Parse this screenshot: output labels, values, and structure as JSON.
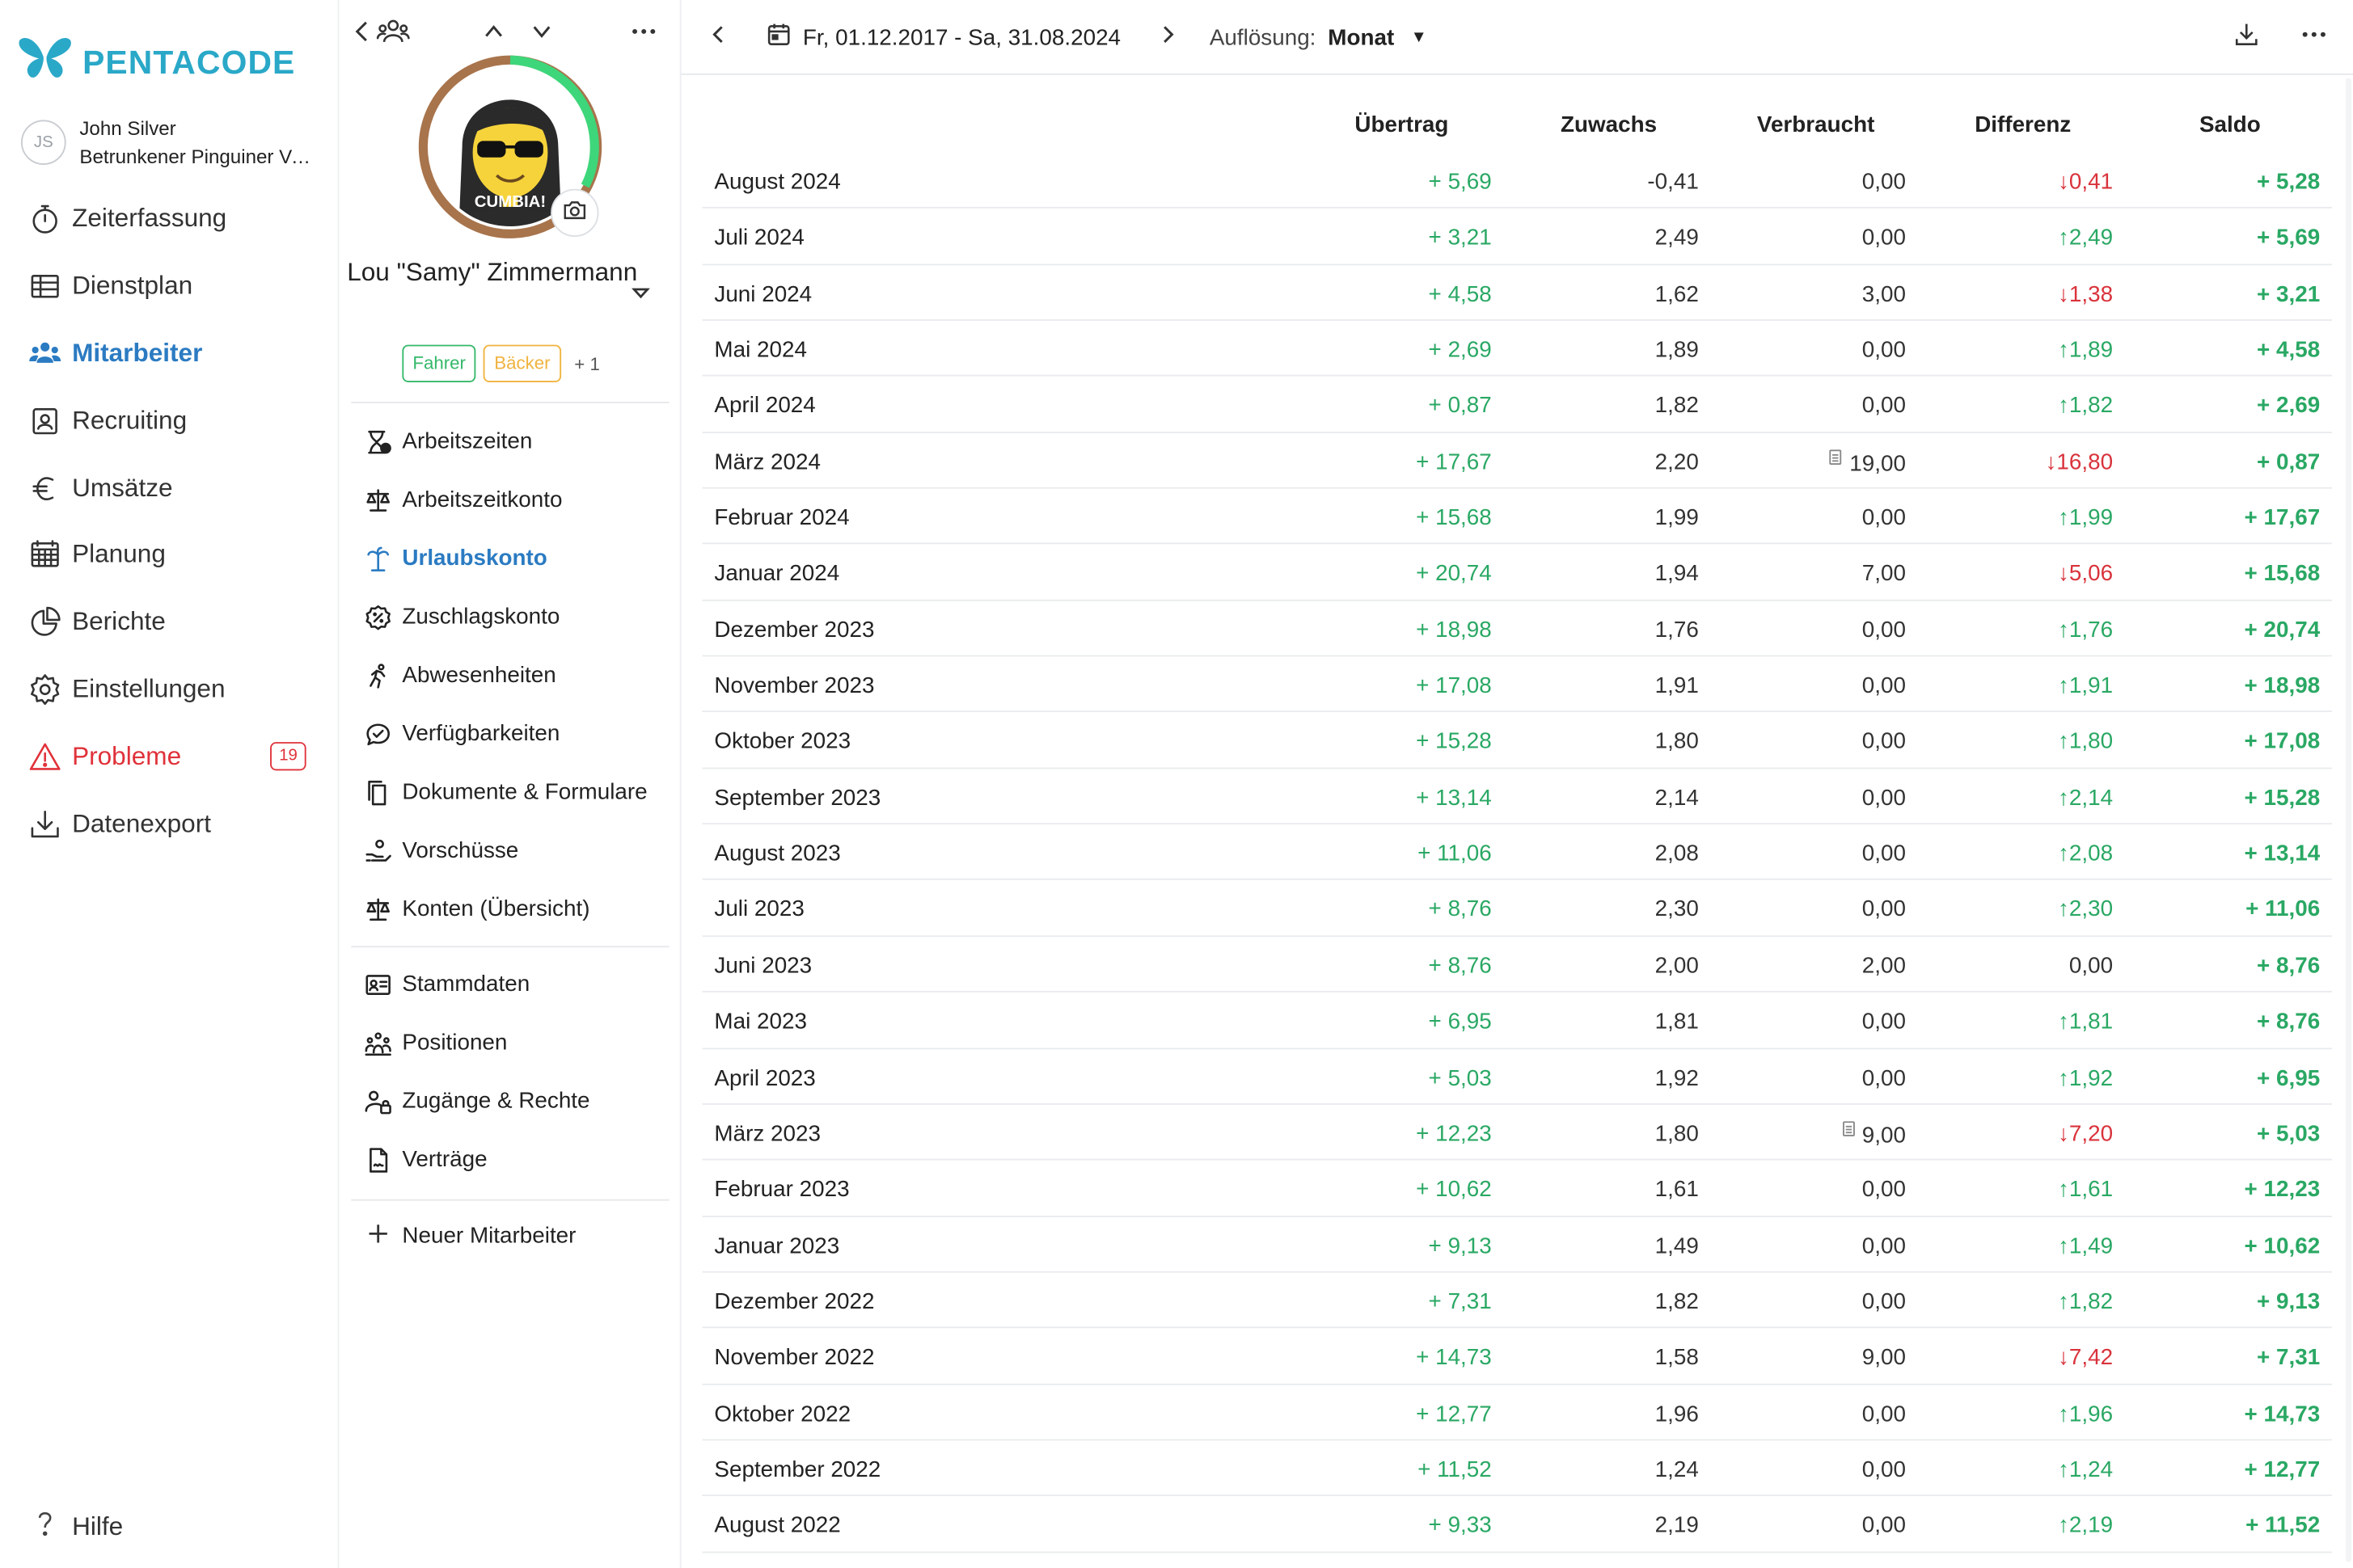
{
  "app": {
    "brand": "PENTACODE",
    "user": {
      "initials": "JS",
      "name": "John Silver",
      "subtitle": "Betrunkener Pinguiner Verwaltung"
    },
    "nav": [
      {
        "id": "zeiterfassung",
        "label": "Zeiterfassung",
        "icon": "stopwatch-icon"
      },
      {
        "id": "dienstplan",
        "label": "Dienstplan",
        "icon": "schedule-table-icon"
      },
      {
        "id": "mitarbeiter",
        "label": "Mitarbeiter",
        "icon": "people-icon",
        "active": true
      },
      {
        "id": "recruiting",
        "label": "Recruiting",
        "icon": "id-badge-icon"
      },
      {
        "id": "umsaetze",
        "label": "Umsätze",
        "icon": "euro-icon"
      },
      {
        "id": "planung",
        "label": "Planung",
        "icon": "calendar-grid-icon"
      },
      {
        "id": "berichte",
        "label": "Berichte",
        "icon": "pie-chart-icon"
      },
      {
        "id": "einstellungen",
        "label": "Einstellungen",
        "icon": "gear-icon"
      },
      {
        "id": "probleme",
        "label": "Probleme",
        "icon": "warning-icon",
        "badge": "19"
      },
      {
        "id": "datenexport",
        "label": "Datenexport",
        "icon": "download-icon"
      }
    ],
    "help_label": "Hilfe",
    "accent": "#2b7bc2",
    "brand_color": "#2aa8c8",
    "positive_color": "#2aa864",
    "negative_color": "#d9333c"
  },
  "employee": {
    "name": "Lou \"Samy\" Zimmermann",
    "avatar_caption": "CUMBIA!",
    "tags": [
      {
        "label": "Fahrer",
        "color": "#35b86a"
      },
      {
        "label": "Bäcker",
        "color": "#f0b33f"
      }
    ],
    "tags_more": "+ 1",
    "menu_primary": [
      {
        "id": "arbeitszeiten",
        "label": "Arbeitszeiten",
        "icon": "hourglass-icon"
      },
      {
        "id": "arbeitszeitkonto",
        "label": "Arbeitszeitkonto",
        "icon": "scales-icon"
      },
      {
        "id": "urlaubskonto",
        "label": "Urlaubskonto",
        "icon": "palm-tree-icon",
        "active": true
      },
      {
        "id": "zuschlagskonto",
        "label": "Zuschlagskonto",
        "icon": "percent-badge-icon"
      },
      {
        "id": "abwesenheiten",
        "label": "Abwesenheiten",
        "icon": "running-person-icon"
      },
      {
        "id": "verfuegbarkeiten",
        "label": "Verfügbarkeiten",
        "icon": "chat-check-icon"
      },
      {
        "id": "dokumente",
        "label": "Dokumente & Formulare",
        "icon": "documents-icon"
      },
      {
        "id": "vorschuesse",
        "label": "Vorschüsse",
        "icon": "hand-coin-icon"
      },
      {
        "id": "konten",
        "label": "Konten (Übersicht)",
        "icon": "scales-icon"
      }
    ],
    "menu_secondary": [
      {
        "id": "stammdaten",
        "label": "Stammdaten",
        "icon": "id-card-icon"
      },
      {
        "id": "positionen",
        "label": "Positionen",
        "icon": "team-icon"
      },
      {
        "id": "zugaenge",
        "label": "Zugänge & Rechte",
        "icon": "user-lock-icon"
      },
      {
        "id": "vertraege",
        "label": "Verträge",
        "icon": "contract-icon"
      }
    ],
    "new_label": "Neuer Mitarbeiter"
  },
  "toolbar": {
    "date_range": "Fr, 01.12.2017 - Sa, 31.08.2024",
    "resolution_label": "Auflösung:",
    "resolution_value": "Monat"
  },
  "table": {
    "columns": [
      "Übertrag",
      "Zuwachs",
      "Verbraucht",
      "Differenz",
      "Saldo"
    ],
    "rows": [
      {
        "label": "August 2024",
        "uebertrag": "5,69",
        "zuwachs": "-0,41",
        "verbraucht": "0,00",
        "differenz": "0,41",
        "diff_dir": "down",
        "saldo": "5,28"
      },
      {
        "label": "Juli 2024",
        "uebertrag": "3,21",
        "zuwachs": "2,49",
        "verbraucht": "0,00",
        "differenz": "2,49",
        "diff_dir": "up",
        "saldo": "5,69"
      },
      {
        "label": "Juni 2024",
        "uebertrag": "4,58",
        "zuwachs": "1,62",
        "verbraucht": "3,00",
        "differenz": "1,38",
        "diff_dir": "down",
        "saldo": "3,21"
      },
      {
        "label": "Mai 2024",
        "uebertrag": "2,69",
        "zuwachs": "1,89",
        "verbraucht": "0,00",
        "differenz": "1,89",
        "diff_dir": "up",
        "saldo": "4,58"
      },
      {
        "label": "April 2024",
        "uebertrag": "0,87",
        "zuwachs": "1,82",
        "verbraucht": "0,00",
        "differenz": "1,82",
        "diff_dir": "up",
        "saldo": "2,69"
      },
      {
        "label": "März 2024",
        "uebertrag": "17,67",
        "zuwachs": "2,20",
        "verbraucht": "19,00",
        "verbraucht_note": true,
        "differenz": "16,80",
        "diff_dir": "down",
        "saldo": "0,87"
      },
      {
        "label": "Februar 2024",
        "uebertrag": "15,68",
        "zuwachs": "1,99",
        "verbraucht": "0,00",
        "differenz": "1,99",
        "diff_dir": "up",
        "saldo": "17,67"
      },
      {
        "label": "Januar 2024",
        "uebertrag": "20,74",
        "zuwachs": "1,94",
        "verbraucht": "7,00",
        "differenz": "5,06",
        "diff_dir": "down",
        "saldo": "15,68"
      },
      {
        "label": "Dezember 2023",
        "uebertrag": "18,98",
        "zuwachs": "1,76",
        "verbraucht": "0,00",
        "differenz": "1,76",
        "diff_dir": "up",
        "saldo": "20,74"
      },
      {
        "label": "November 2023",
        "uebertrag": "17,08",
        "zuwachs": "1,91",
        "verbraucht": "0,00",
        "differenz": "1,91",
        "diff_dir": "up",
        "saldo": "18,98"
      },
      {
        "label": "Oktober 2023",
        "uebertrag": "15,28",
        "zuwachs": "1,80",
        "verbraucht": "0,00",
        "differenz": "1,80",
        "diff_dir": "up",
        "saldo": "17,08"
      },
      {
        "label": "September 2023",
        "uebertrag": "13,14",
        "zuwachs": "2,14",
        "verbraucht": "0,00",
        "differenz": "2,14",
        "diff_dir": "up",
        "saldo": "15,28"
      },
      {
        "label": "August 2023",
        "uebertrag": "11,06",
        "zuwachs": "2,08",
        "verbraucht": "0,00",
        "differenz": "2,08",
        "diff_dir": "up",
        "saldo": "13,14"
      },
      {
        "label": "Juli 2023",
        "uebertrag": "8,76",
        "zuwachs": "2,30",
        "verbraucht": "0,00",
        "differenz": "2,30",
        "diff_dir": "up",
        "saldo": "11,06"
      },
      {
        "label": "Juni 2023",
        "uebertrag": "8,76",
        "zuwachs": "2,00",
        "verbraucht": "2,00",
        "differenz": "0,00",
        "diff_dir": "none",
        "saldo": "8,76"
      },
      {
        "label": "Mai 2023",
        "uebertrag": "6,95",
        "zuwachs": "1,81",
        "verbraucht": "0,00",
        "differenz": "1,81",
        "diff_dir": "up",
        "saldo": "8,76"
      },
      {
        "label": "April 2023",
        "uebertrag": "5,03",
        "zuwachs": "1,92",
        "verbraucht": "0,00",
        "differenz": "1,92",
        "diff_dir": "up",
        "saldo": "6,95"
      },
      {
        "label": "März 2023",
        "uebertrag": "12,23",
        "zuwachs": "1,80",
        "verbraucht": "9,00",
        "verbraucht_note": true,
        "differenz": "7,20",
        "diff_dir": "down",
        "saldo": "5,03"
      },
      {
        "label": "Februar 2023",
        "uebertrag": "10,62",
        "zuwachs": "1,61",
        "verbraucht": "0,00",
        "differenz": "1,61",
        "diff_dir": "up",
        "saldo": "12,23"
      },
      {
        "label": "Januar 2023",
        "uebertrag": "9,13",
        "zuwachs": "1,49",
        "verbraucht": "0,00",
        "differenz": "1,49",
        "diff_dir": "up",
        "saldo": "10,62"
      },
      {
        "label": "Dezember 2022",
        "uebertrag": "7,31",
        "zuwachs": "1,82",
        "verbraucht": "0,00",
        "differenz": "1,82",
        "diff_dir": "up",
        "saldo": "9,13"
      },
      {
        "label": "November 2022",
        "uebertrag": "14,73",
        "zuwachs": "1,58",
        "verbraucht": "9,00",
        "differenz": "7,42",
        "diff_dir": "down",
        "saldo": "7,31"
      },
      {
        "label": "Oktober 2022",
        "uebertrag": "12,77",
        "zuwachs": "1,96",
        "verbraucht": "0,00",
        "differenz": "1,96",
        "diff_dir": "up",
        "saldo": "14,73"
      },
      {
        "label": "September 2022",
        "uebertrag": "11,52",
        "zuwachs": "1,24",
        "verbraucht": "0,00",
        "differenz": "1,24",
        "diff_dir": "up",
        "saldo": "12,77"
      },
      {
        "label": "August 2022",
        "uebertrag": "9,33",
        "zuwachs": "2,19",
        "verbraucht": "0,00",
        "differenz": "2,19",
        "diff_dir": "up",
        "saldo": "11,52"
      }
    ]
  }
}
